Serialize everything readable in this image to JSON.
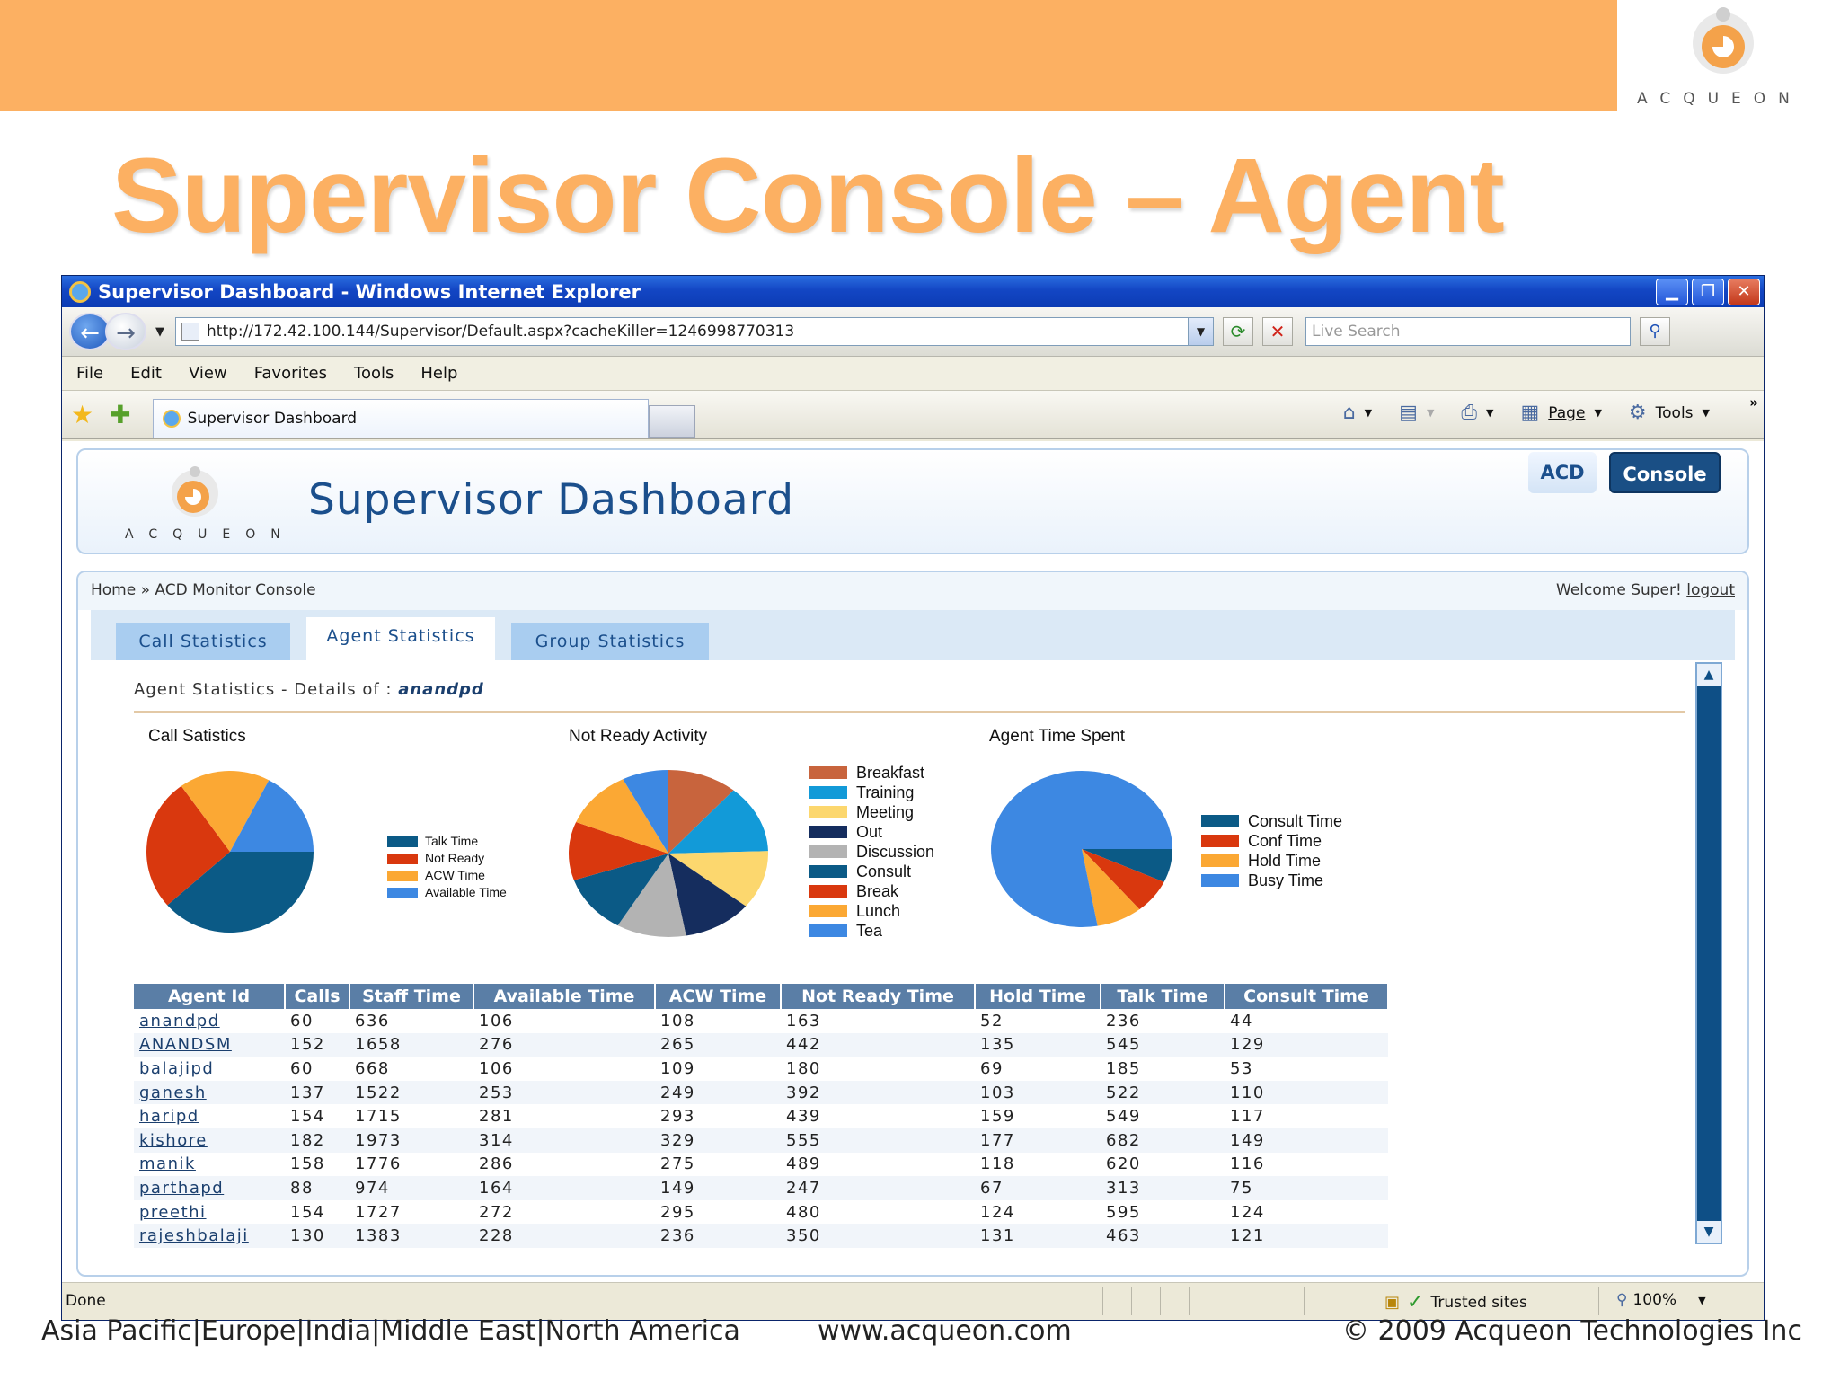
{
  "slide": {
    "title": "Supervisor Console – Agent",
    "logo_text": "ACQUEON",
    "footer_regions": "Asia Pacific|Europe|India|Middle East|North America",
    "footer_url": "www.acqueon.com",
    "footer_copyright": "© 2009 Acqueon Technologies Inc"
  },
  "browser": {
    "window_title": "Supervisor Dashboard - Windows Internet Explorer",
    "url": "http://172.42.100.144/Supervisor/Default.aspx?cacheKiller=1246998770313",
    "search_placeholder": "Live Search",
    "menu": [
      "File",
      "Edit",
      "View",
      "Favorites",
      "Tools",
      "Help"
    ],
    "tab_label": "Supervisor Dashboard",
    "cmd_page": "Page",
    "cmd_tools": "Tools",
    "status_done": "Done",
    "status_zone": "Trusted sites",
    "status_zoom": "100%"
  },
  "dashboard": {
    "logo_text": "ACQUEON",
    "title": "Supervisor Dashboard",
    "btn_acd": "ACD",
    "btn_console": "Console",
    "breadcrumb": "Home » ACD Monitor Console",
    "welcome": "Welcome Super!",
    "logout": "logout",
    "tabs": [
      "Call Statistics",
      "Agent Statistics",
      "Group Statistics"
    ],
    "active_tab": "Agent Statistics",
    "details_label": "Agent Statistics - Details of :",
    "details_agent": "anandpd"
  },
  "chart_data": [
    {
      "type": "pie",
      "title": "Call Satistics",
      "labels": [
        "Talk Time",
        "Not Ready",
        "ACW Time",
        "Available Time"
      ],
      "values": [
        236,
        163,
        108,
        106
      ],
      "colors": [
        "#0b5a86",
        "#d9380e",
        "#fba834",
        "#3d88e2"
      ]
    },
    {
      "type": "pie",
      "title": "Not Ready Activity",
      "labels": [
        "Breakfast",
        "Training",
        "Meeting",
        "Out",
        "Discussion",
        "Consult",
        "Break",
        "Lunch",
        "Tea"
      ],
      "values": [
        12,
        14,
        12,
        12,
        12,
        12,
        12,
        12,
        8
      ],
      "colors": [
        "#c8643d",
        "#129ad8",
        "#fcd76e",
        "#152d5e",
        "#b3b3b3",
        "#0b5a86",
        "#d9380e",
        "#fba834",
        "#3d88e2"
      ]
    },
    {
      "type": "pie",
      "title": "Agent Time Spent",
      "labels": [
        "Consult Time",
        "Conf Time",
        "Hold Time",
        "Busy Time"
      ],
      "values": [
        44,
        45,
        52,
        494
      ],
      "colors": [
        "#0b5a86",
        "#d9380e",
        "#fba834",
        "#3d88e2"
      ]
    },
    {
      "type": "table",
      "columns": [
        "Agent Id",
        "Calls",
        "Staff Time",
        "Available Time",
        "ACW Time",
        "Not Ready Time",
        "Hold Time",
        "Talk Time",
        "Consult Time"
      ],
      "rows": [
        [
          "anandpd",
          "60",
          "636",
          "106",
          "108",
          "163",
          "52",
          "236",
          "44"
        ],
        [
          "ANANDSM",
          "152",
          "1658",
          "276",
          "265",
          "442",
          "135",
          "545",
          "129"
        ],
        [
          "balajipd",
          "60",
          "668",
          "106",
          "109",
          "180",
          "69",
          "185",
          "53"
        ],
        [
          "ganesh",
          "137",
          "1522",
          "253",
          "249",
          "392",
          "103",
          "522",
          "110"
        ],
        [
          "haripd",
          "154",
          "1715",
          "281",
          "293",
          "439",
          "159",
          "549",
          "117"
        ],
        [
          "kishore",
          "182",
          "1973",
          "314",
          "329",
          "555",
          "177",
          "682",
          "149"
        ],
        [
          "manik",
          "158",
          "1776",
          "286",
          "275",
          "489",
          "118",
          "620",
          "116"
        ],
        [
          "parthapd",
          "88",
          "974",
          "164",
          "149",
          "247",
          "67",
          "313",
          "75"
        ],
        [
          "preethi",
          "154",
          "1727",
          "272",
          "295",
          "480",
          "124",
          "595",
          "124"
        ],
        [
          "rajeshbalaji",
          "130",
          "1383",
          "228",
          "236",
          "350",
          "131",
          "463",
          "121"
        ]
      ]
    }
  ]
}
